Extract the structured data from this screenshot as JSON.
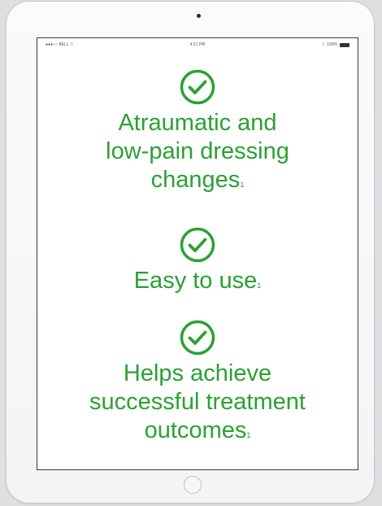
{
  "status_bar": {
    "carrier": "●●●○○ BELL",
    "wifi_icon": "wifi-icon",
    "time": "4:21 PM",
    "bluetooth_icon": "bluetooth-icon",
    "battery_percent": "100%"
  },
  "benefits": [
    {
      "icon": "checkmark-circle-icon",
      "lines": [
        "Atraumatic and",
        "low-pain dressing",
        "changes"
      ],
      "footnote": "1"
    },
    {
      "icon": "checkmark-circle-icon",
      "lines": [
        "Easy to use"
      ],
      "footnote": "1"
    },
    {
      "icon": "checkmark-circle-icon",
      "lines": [
        "Helps achieve",
        "successful treatment",
        "outcomes"
      ],
      "footnote": "1"
    }
  ],
  "colors": {
    "accent_green": "#2aa133",
    "screen_bg": "#ffffff",
    "device_frame": "#f7f7f8"
  }
}
